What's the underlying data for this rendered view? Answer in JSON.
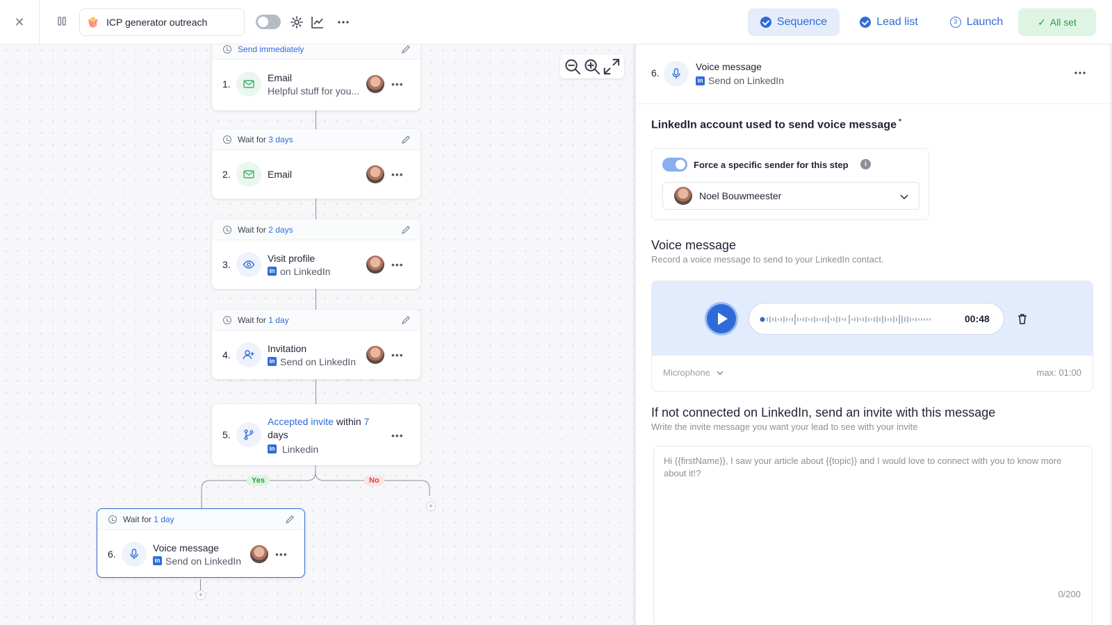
{
  "topbar": {
    "campaign_name": "ICP generator outreach",
    "campaign_emoji": "🍿",
    "nav": [
      {
        "label": "Sequence",
        "state": "completed",
        "active": true
      },
      {
        "label": "Lead list",
        "state": "completed",
        "active": false
      },
      {
        "label": "Launch",
        "state": "step",
        "number": "3",
        "active": false
      }
    ],
    "status_label": "All set",
    "status_color": "#2d9a48"
  },
  "sequence": {
    "steps": [
      {
        "number": "1.",
        "head_prefix": "Send immediately",
        "head_value": "",
        "title": "Email",
        "subtitle": "Helpful stuff for you...",
        "icon": "mail-icon",
        "channel": ""
      },
      {
        "number": "2.",
        "head_prefix": "Wait for ",
        "head_value": "3 days",
        "title": "Email",
        "subtitle": "",
        "icon": "mail-icon",
        "channel": ""
      },
      {
        "number": "3.",
        "head_prefix": "Wait for ",
        "head_value": "2 days",
        "title": "Visit profile",
        "subtitle": "on LinkedIn",
        "icon": "eye-icon",
        "channel": "in"
      },
      {
        "number": "4.",
        "head_prefix": "Wait for ",
        "head_value": "1 day",
        "title": "Invitation",
        "subtitle": "Send on LinkedIn",
        "icon": "add-user-icon",
        "channel": "in"
      }
    ],
    "condition": {
      "number": "5.",
      "link_text": "Accepted invite",
      "middle": " within ",
      "value": "7",
      "suffix": "days",
      "channel_label": "Linkedin"
    },
    "branch_yes": "Yes",
    "branch_no": "No",
    "selected_step": {
      "number": "6.",
      "head_prefix": "Wait for ",
      "head_value": "1 day",
      "title": "Voice message",
      "subtitle": "Send on LinkedIn"
    }
  },
  "panel": {
    "header": {
      "number": "6.",
      "title": "Voice message",
      "subtitle": "Send on LinkedIn"
    },
    "account_section": {
      "title": "LinkedIn account used to send voice message",
      "required_mark": "*",
      "toggle_label": "Force a specific sender for this step",
      "toggle_on": true,
      "sender": "Noel Bouwmeester"
    },
    "voice_section": {
      "title": "Voice message",
      "subtitle": "Record a voice message to send to your LinkedIn contact.",
      "duration": "00:48",
      "microphone_label": "Microphone",
      "max_label": "max: 01:00"
    },
    "invite_section": {
      "title": "If not connected on LinkedIn, send an invite with this message",
      "subtitle": "Write the invite message you want your lead to see with your invite",
      "message": "Hi {{firstName}}, I saw your article about {{topic}} and I would love to connect with you to know more about it!?",
      "char_count": "0/200"
    }
  }
}
